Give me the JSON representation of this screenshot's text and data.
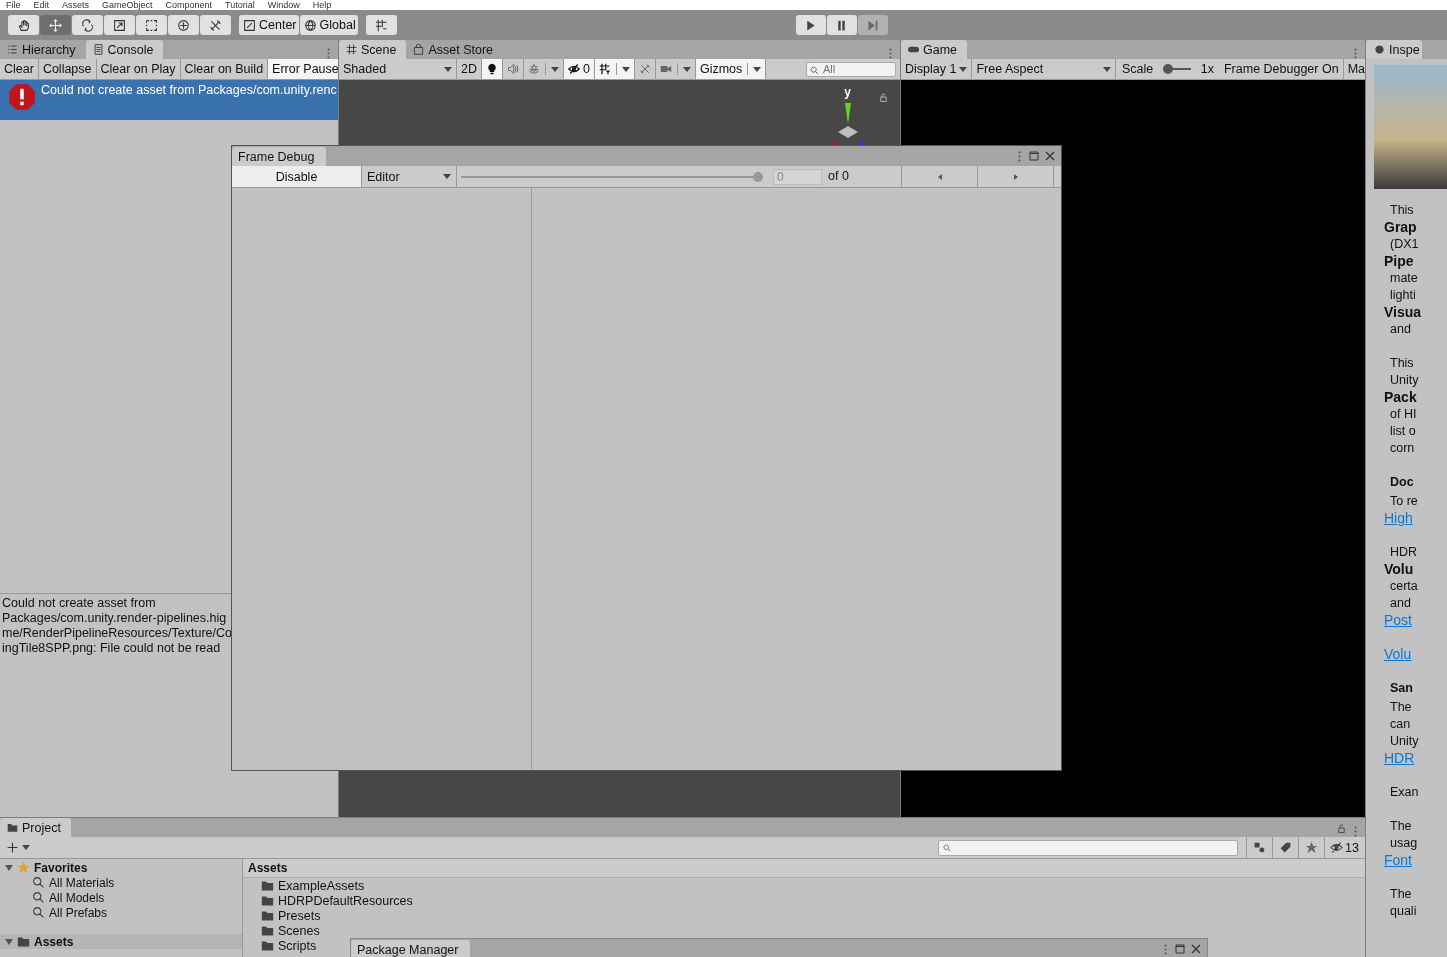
{
  "menu_bar": {
    "items": [
      "File",
      "Edit",
      "Assets",
      "GameObject",
      "Component",
      "Tutorial",
      "Window",
      "Help"
    ]
  },
  "toolbar": {
    "tools": [
      {
        "kind": "hand",
        "selected": false
      },
      {
        "kind": "move",
        "selected": true
      },
      {
        "kind": "rotate",
        "selected": false
      },
      {
        "kind": "scale",
        "selected": false
      },
      {
        "kind": "rect",
        "selected": false
      },
      {
        "kind": "transform",
        "selected": false
      },
      {
        "kind": "custom",
        "selected": false
      }
    ],
    "pivot_buttons": [
      {
        "label": "Center",
        "kind": "pivot"
      },
      {
        "label": "Global",
        "kind": "global"
      }
    ],
    "playback": [
      {
        "kind": "play",
        "disabled": false
      },
      {
        "kind": "pause",
        "disabled": false
      },
      {
        "kind": "step",
        "disabled": true
      }
    ]
  },
  "console": {
    "tabs": [
      {
        "label": "Hierarchy",
        "kind": "hierarchy",
        "selected": false
      },
      {
        "label": "Console",
        "kind": "console",
        "selected": true
      }
    ],
    "buttons": [
      {
        "label": "Clear",
        "on": false
      },
      {
        "label": "Collapse",
        "on": false
      },
      {
        "label": "Clear on Play",
        "on": false
      },
      {
        "label": "Clear on Build",
        "on": false
      },
      {
        "label": "Error Pause",
        "on": true
      }
    ],
    "entries": [
      {
        "kind": "error",
        "text": "Could not create asset from Packages/com.unity.renc",
        "selected": true
      }
    ],
    "detail": "Could not create asset from\nPackages/com.unity.render-pipelines.hig\nme/RenderPipelineResources/Texture/Co\ningTile8SPP.png: File could not be read"
  },
  "scene": {
    "tabs": [
      {
        "label": "Scene",
        "kind": "scene",
        "selected": true
      },
      {
        "label": "Asset Store",
        "kind": "store",
        "selected": false
      }
    ],
    "shading": "Shaded",
    "mode_2d": {
      "label": "2D",
      "on": false
    },
    "toggles": [
      {
        "kind": "lighting",
        "on": true,
        "menu": false
      },
      {
        "kind": "audio",
        "on": false,
        "menu": false
      },
      {
        "kind": "effects",
        "on": false,
        "menu": true
      },
      {
        "kind": "visibility",
        "on": true,
        "menu": false,
        "label": "0"
      },
      {
        "kind": "grid",
        "on": true,
        "menu": true
      },
      {
        "kind": "tools",
        "on": false,
        "menu": false
      },
      {
        "kind": "camera",
        "on": false,
        "menu": true
      },
      {
        "kind": "gizmos",
        "on": true,
        "menu": true,
        "label": "Gizmos"
      }
    ],
    "search": {
      "placeholder": "All"
    },
    "axis_label": "y"
  },
  "game": {
    "tab": {
      "label": "Game",
      "selected": true
    },
    "display": "Display 1",
    "aspect": "Free Aspect",
    "scale": {
      "label": "Scale",
      "level": 0,
      "reading": "1x"
    },
    "frame_debugger": "Frame Debugger On",
    "column_cut": "Ma"
  },
  "inspector": {
    "tab": "Inspe",
    "paragraphs": [
      {
        "kind": "text",
        "lines": [
          {
            "text": "This",
            "kind": "plain"
          },
          {
            "text": "Grap",
            "kind": "bold"
          },
          {
            "text": "(DX1",
            "kind": "plain"
          },
          {
            "text": "Pipe",
            "kind": "bold"
          },
          {
            "text": "mate",
            "kind": "plain"
          },
          {
            "text": "lighti",
            "kind": "plain"
          },
          {
            "text": "Visua",
            "kind": "bold"
          },
          {
            "text": "and",
            "kind": "plain"
          }
        ]
      },
      {
        "kind": "text",
        "lines": [
          {
            "text": "This",
            "kind": "plain"
          },
          {
            "text": "Unity",
            "kind": "plain"
          },
          {
            "text": "Pack",
            "kind": "bold"
          },
          {
            "text": "of HI",
            "kind": "plain"
          },
          {
            "text": "list o",
            "kind": "plain"
          },
          {
            "text": "corn",
            "kind": "plain"
          }
        ]
      },
      {
        "kind": "heading",
        "lines": [
          {
            "text": "Doc",
            "kind": "plain"
          }
        ]
      },
      {
        "kind": "text",
        "lines": [
          {
            "text": "To re",
            "kind": "plain"
          },
          {
            "text": "High",
            "kind": "link"
          }
        ]
      },
      {
        "kind": "text",
        "lines": [
          {
            "text": "HDR",
            "kind": "plain"
          },
          {
            "text": "Volu",
            "kind": "bold"
          },
          {
            "text": "certa",
            "kind": "plain"
          },
          {
            "text": "and",
            "kind": "plain"
          },
          {
            "text": "Post",
            "kind": "link"
          }
        ]
      },
      {
        "kind": "text",
        "lines": [
          {
            "text": "Volu",
            "kind": "link"
          }
        ]
      },
      {
        "kind": "heading",
        "lines": [
          {
            "text": "San",
            "kind": "plain"
          }
        ]
      },
      {
        "kind": "text",
        "lines": [
          {
            "text": "The",
            "kind": "plain"
          },
          {
            "text": "can",
            "kind": "plain"
          },
          {
            "text": "Unity",
            "kind": "plain"
          },
          {
            "text": "HDR",
            "kind": "link"
          }
        ]
      },
      {
        "kind": "text",
        "lines": [
          {
            "text": "Exan",
            "kind": "plain"
          }
        ]
      },
      {
        "kind": "text",
        "lines": [
          {
            "text": "The",
            "kind": "plain"
          },
          {
            "text": "usag",
            "kind": "plain"
          },
          {
            "text": "Font",
            "kind": "link"
          }
        ]
      },
      {
        "kind": "text",
        "lines": [
          {
            "text": "The",
            "kind": "plain"
          },
          {
            "text": "quali",
            "kind": "plain"
          }
        ]
      }
    ]
  },
  "frame_debug": {
    "title": "Frame Debug",
    "disable_button": "Disable",
    "target": "Editor",
    "slider": {
      "level": 1
    },
    "event_index": "0",
    "event_total": "of 0"
  },
  "project": {
    "tab": "Project",
    "hidden_count": "13",
    "tree": [
      {
        "label": "Favorites",
        "kind": "favorites",
        "expanded": true,
        "selected": false,
        "children": [
          {
            "label": "All Materials",
            "kind": "search",
            "selected": false
          },
          {
            "label": "All Models",
            "kind": "search",
            "selected": false
          },
          {
            "label": "All Prefabs",
            "kind": "search",
            "selected": false
          }
        ]
      },
      {
        "label": "Assets",
        "kind": "folder",
        "expanded": true,
        "selected": true
      }
    ],
    "breadcrumb": "Assets",
    "folders": [
      "ExampleAssets",
      "HDRPDefaultResources",
      "Presets",
      "Scenes",
      "Scripts"
    ]
  },
  "package_manager": {
    "title": "Package Manager"
  }
}
